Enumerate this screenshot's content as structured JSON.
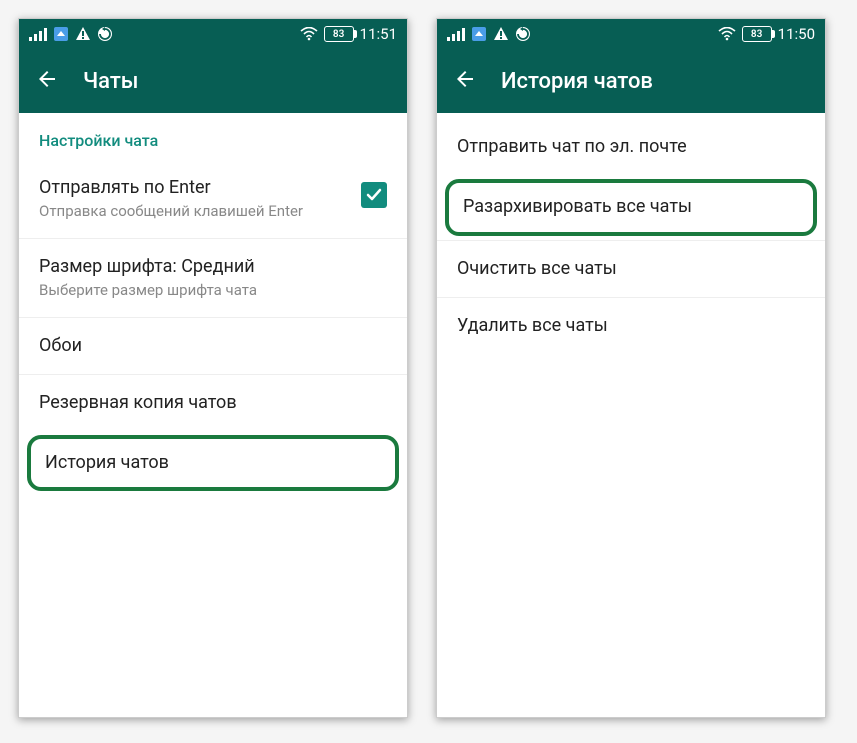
{
  "left": {
    "statusbar": {
      "battery": "83",
      "time": "11:51"
    },
    "appbar": {
      "title": "Чаты"
    },
    "section_header": "Настройки чата",
    "rows": {
      "enter": {
        "title": "Отправлять по Enter",
        "sub": "Отправка сообщений клавишей Enter"
      },
      "font": {
        "title": "Размер шрифта: Средний",
        "sub": "Выберите размер шрифта чата"
      },
      "wallpaper": {
        "title": "Обои"
      },
      "backup": {
        "title": "Резервная копия чатов"
      },
      "history": {
        "title": "История чатов"
      }
    }
  },
  "right": {
    "statusbar": {
      "battery": "83",
      "time": "11:50"
    },
    "appbar": {
      "title": "История чатов"
    },
    "rows": {
      "email": {
        "title": "Отправить чат по эл. почте"
      },
      "unarchive": {
        "title": "Разархивировать все чаты"
      },
      "clear": {
        "title": "Очистить все чаты"
      },
      "delete": {
        "title": "Удалить все чаты"
      }
    }
  }
}
